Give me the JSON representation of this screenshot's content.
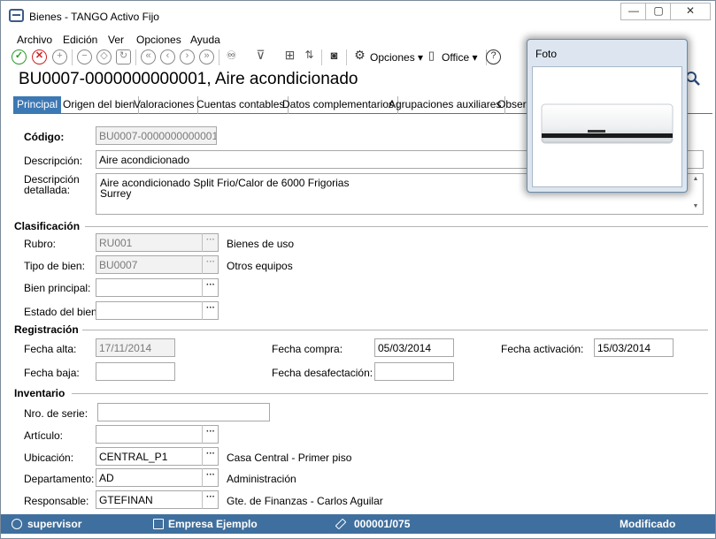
{
  "window": {
    "title": "Bienes - TANGO Activo Fijo",
    "buttons": {
      "minimize": "—",
      "maximize": "▢",
      "close": "✕"
    }
  },
  "menu": [
    "Archivo",
    "Edición",
    "Ver",
    "Opciones",
    "Ayuda"
  ],
  "toolbar": {
    "opciones_label": "Opciones",
    "office_label": "Office"
  },
  "record": {
    "title": "BU0007-0000000000001, Aire acondicionado"
  },
  "tabs": [
    "Principal",
    "Origen del bien",
    "Valoraciones",
    "Cuentas contables",
    "Datos complementarios",
    "Agrupaciones auxiliares",
    "Observ"
  ],
  "form": {
    "codigo": {
      "label": "Código:",
      "value": "BU0007-0000000000001"
    },
    "descripcion": {
      "label": "Descripción:",
      "value": "Aire acondicionado"
    },
    "descripcion_detallada": {
      "label": "Descripción detallada:",
      "lines": [
        "Aire acondicionado Split Frio/Calor de 6000 Frigorias",
        "Surrey"
      ]
    },
    "clasificacion": {
      "title": "Clasificación",
      "rubro": {
        "label": "Rubro:",
        "value": "RU001",
        "desc": "Bienes de uso"
      },
      "tipo_bien": {
        "label": "Tipo de bien:",
        "value": "BU0007",
        "desc": "Otros equipos"
      },
      "bien_principal": {
        "label": "Bien principal:",
        "value": ""
      },
      "estado_bien": {
        "label": "Estado del bien:",
        "value": ""
      }
    },
    "registracion": {
      "title": "Registración",
      "fecha_alta": {
        "label": "Fecha alta:",
        "value": "17/11/2014"
      },
      "fecha_compra": {
        "label": "Fecha compra:",
        "value": "05/03/2014"
      },
      "fecha_activacion": {
        "label": "Fecha activación:",
        "value": "15/03/2014"
      },
      "fecha_baja": {
        "label": "Fecha baja:",
        "value": ""
      },
      "fecha_desafectacion": {
        "label": "Fecha desafectación:",
        "value": ""
      }
    },
    "inventario": {
      "title": "Inventario",
      "nro_serie": {
        "label": "Nro. de serie:",
        "value": ""
      },
      "articulo": {
        "label": "Artículo:",
        "value": ""
      },
      "ubicacion": {
        "label": "Ubicación:",
        "value": "CENTRAL_P1",
        "desc": "Casa Central - Primer piso"
      },
      "departamento": {
        "label": "Departamento:",
        "value": "AD",
        "desc": "Administración"
      },
      "responsable": {
        "label": "Responsable:",
        "value": "GTEFINAN",
        "desc": "Gte. de Finanzas - Carlos Aguilar"
      }
    }
  },
  "statusbar": {
    "user": "supervisor",
    "company": "Empresa Ejemplo",
    "number": "000001/075",
    "state": "Modificado"
  },
  "foto": {
    "title": "Foto"
  },
  "colors": {
    "accent": "#3c78b4",
    "statusbar": "#3f6f9e"
  }
}
